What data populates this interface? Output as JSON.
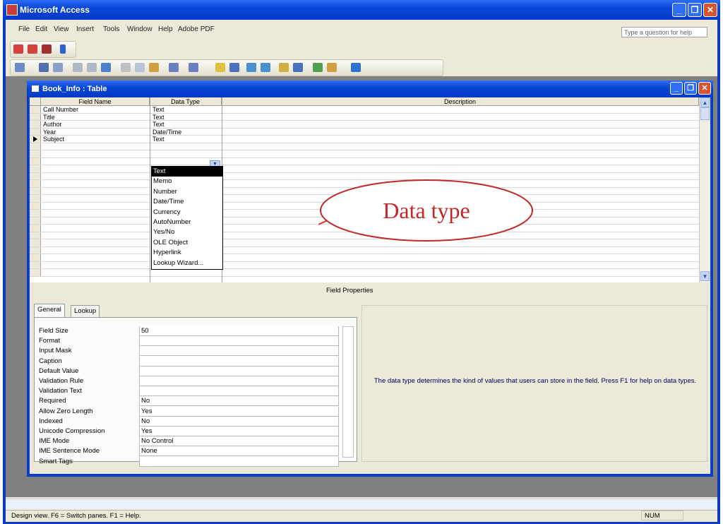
{
  "app": {
    "title": "Microsoft Access"
  },
  "menu": [
    "File",
    "Edit",
    "View",
    "Insert",
    "Tools",
    "Window",
    "Help",
    "Adobe PDF"
  ],
  "help_box": {
    "placeholder": "Type a question for help"
  },
  "table_window": {
    "title": "Book_Info : Table"
  },
  "grid": {
    "headers": {
      "field_name": "Field Name",
      "data_type": "Data Type",
      "description": "Description"
    },
    "rows": [
      {
        "field": "Call Number",
        "type": "Text"
      },
      {
        "field": "Title",
        "type": "Text"
      },
      {
        "field": "Author",
        "type": "Text"
      },
      {
        "field": "Year",
        "type": "Date/Time"
      },
      {
        "field": "Subject",
        "type": "Text"
      }
    ]
  },
  "dropdown": {
    "options": [
      "Text",
      "Memo",
      "Number",
      "Date/Time",
      "Currency",
      "AutoNumber",
      "Yes/No",
      "OLE Object",
      "Hyperlink",
      "Lookup Wizard..."
    ],
    "selected": "Text"
  },
  "annotation": {
    "text": "Data type"
  },
  "field_properties": {
    "label": "Field Properties",
    "tabs": [
      "General",
      "Lookup"
    ],
    "properties": [
      {
        "name": "Field Size",
        "value": "50"
      },
      {
        "name": "Format",
        "value": ""
      },
      {
        "name": "Input Mask",
        "value": ""
      },
      {
        "name": "Caption",
        "value": ""
      },
      {
        "name": "Default Value",
        "value": ""
      },
      {
        "name": "Validation Rule",
        "value": ""
      },
      {
        "name": "Validation Text",
        "value": ""
      },
      {
        "name": "Required",
        "value": "No"
      },
      {
        "name": "Allow Zero Length",
        "value": "Yes"
      },
      {
        "name": "Indexed",
        "value": "No"
      },
      {
        "name": "Unicode Compression",
        "value": "Yes"
      },
      {
        "name": "IME Mode",
        "value": "No Control"
      },
      {
        "name": "IME Sentence Mode",
        "value": "None"
      },
      {
        "name": "Smart Tags",
        "value": ""
      }
    ],
    "help": "The data type determines the kind of values that users can store in the field.  Press F1 for help on data types."
  },
  "status": {
    "text": "Design view.  F6 = Switch panes.  F1 = Help.",
    "num": "NUM"
  }
}
